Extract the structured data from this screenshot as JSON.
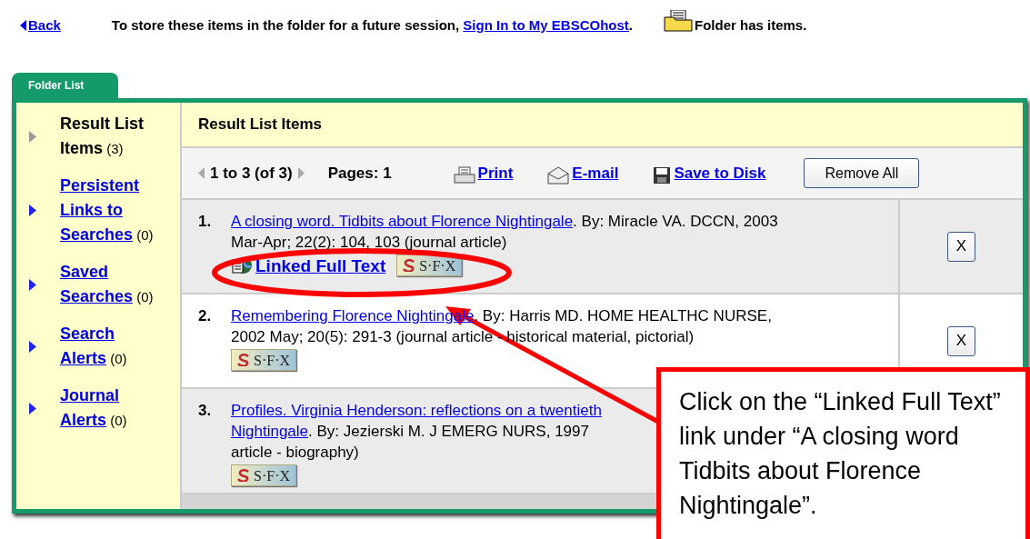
{
  "top_bar": {
    "back": "Back",
    "message": "To store these items in the folder for a future session,",
    "sign_in": "Sign In to My EBSCOhost",
    "period": ".",
    "folder_status": "Folder has items."
  },
  "tab": {
    "label": "Folder List",
    "selected": true
  },
  "sidebar": {
    "items": [
      {
        "label": "Result List Items",
        "count": "(3)",
        "selected": true
      },
      {
        "label": "Persistent Links to Searches",
        "count": "(0)",
        "selected": false
      },
      {
        "label": "Saved Searches",
        "count": "(0)",
        "selected": false
      },
      {
        "label": "Search Alerts",
        "count": "(0)",
        "selected": false
      },
      {
        "label": "Journal Alerts",
        "count": "(0)",
        "selected": false
      }
    ]
  },
  "content": {
    "title": "Result List Items",
    "toolbar": {
      "range": "1 to 3 (of 3)",
      "pages": "Pages: 1",
      "actions": [
        {
          "kind": "print",
          "label": "Print"
        },
        {
          "kind": "email",
          "label": "E-mail"
        },
        {
          "kind": "save",
          "label": "Save to Disk"
        }
      ],
      "remove_all": "Remove All"
    },
    "rows": [
      {
        "number": "1.",
        "lines": [
          [
            {
              "text": "A closing word. Tidbits about Florence Nightingale",
              "link": true
            },
            {
              "text": ". By: Miracle VA. DCCN, 2003",
              "link": false
            }
          ],
          [
            {
              "text": "Mar-Apr; 22(2): 104, 103 (journal article)",
              "link": false
            }
          ]
        ],
        "links": [
          {
            "kind": "fulltext",
            "label": "Linked Full Text"
          },
          {
            "kind": "sfx",
            "label": "S·F·X"
          }
        ],
        "remove": "X"
      },
      {
        "number": "2.",
        "lines": [
          [
            {
              "text": "Remembering Florence Nightingale",
              "link": true
            },
            {
              "text": ". By: Harris MD. HOME HEALTHC NURSE,",
              "link": false
            }
          ],
          [
            {
              "text": "2002 May; 20(5): 291-3 (journal article - historical material, pictorial)",
              "link": false
            }
          ]
        ],
        "links": [
          {
            "kind": "sfx",
            "label": "S·F·X"
          }
        ],
        "remove": "X"
      },
      {
        "number": "3.",
        "lines": [
          [
            {
              "text": "Profiles. Virginia Henderson: reflections on a twentieth",
              "link": true
            }
          ],
          [
            {
              "text": "Nightingale",
              "link": true
            },
            {
              "text": ". By: Jezierski M. J EMERG NURS, 1997",
              "link": false
            }
          ],
          [
            {
              "text": "article - biography)",
              "link": false
            }
          ]
        ],
        "links": [
          {
            "kind": "sfx",
            "label": "S·F·X"
          }
        ]
      }
    ]
  },
  "callout": {
    "text": "Click on the “Linked Full Text” link under “A closing word Tidbits about Florence Nightingale”."
  }
}
